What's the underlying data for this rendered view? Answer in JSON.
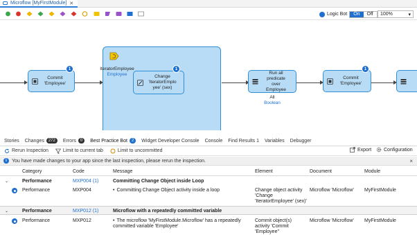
{
  "tab": {
    "title": "Microflow [MyFirstModule]",
    "close": "✕"
  },
  "toolbar": {
    "logic_bot_label": "Logic Bot",
    "toggle_on": "On",
    "toggle_off": "Off",
    "zoom": "100%",
    "zoom_chevron": "▾"
  },
  "canvas": {
    "nodes": [
      {
        "text": "Commit\n'Employee'",
        "badge": "1"
      },
      {
        "text": "Change\n'IteratorEmplo\nyee' (sex)",
        "badge": "1"
      },
      {
        "text": "Run all\npredicate\nover\nEmployee",
        "badge": ""
      },
      {
        "text": "Commit\n'Employee'",
        "badge": "1"
      }
    ],
    "loop": {
      "iterator": "IteratorEmployee",
      "list": "Employee"
    },
    "aggregate": {
      "func": "All",
      "type": "Boolean"
    }
  },
  "panel": {
    "tabs": [
      {
        "label": "Stories",
        "count": ""
      },
      {
        "label": "Changes",
        "count": "272"
      },
      {
        "label": "Errors",
        "count": "0"
      },
      {
        "label": "Best Practice Bot",
        "count": "2"
      },
      {
        "label": "Widget Developer Console",
        "count": ""
      },
      {
        "label": "Console",
        "count": ""
      },
      {
        "label": "Find Results 1",
        "count": ""
      },
      {
        "label": "Variables",
        "count": ""
      },
      {
        "label": "Debugger",
        "count": ""
      }
    ],
    "actions": {
      "rerun": "Rerun Inspection",
      "limit_tab": "Limit to current tab",
      "limit_uncommitted": "Limit to uncommitted",
      "export": "Export",
      "configuration": "Configuration"
    },
    "banner": "You have made changes to your app since the last inspection, please rerun the inspection.",
    "columns": {
      "category": "Category",
      "code": "Code",
      "message": "Message",
      "element": "Element",
      "document": "Document",
      "module": "Module"
    },
    "groups": [
      {
        "category": "Performance",
        "code": "MXP004",
        "count": "(1)",
        "message": "Committing Change Object inside Loop",
        "rows": [
          {
            "category": "Performance",
            "code": "MXP004",
            "message": "Committing Change Object activity inside a loop",
            "element": "Change object activity 'Change 'IteratorEmployee' (sex)'",
            "document": "Microflow 'Microflow'",
            "module": "MyFirstModule"
          }
        ]
      },
      {
        "category": "Performance",
        "code": "MXP012",
        "count": "(1)",
        "message": "Microflow with a repeatedly committed variable",
        "rows": [
          {
            "category": "Performance",
            "code": "MXP012",
            "message": "The microflow 'MyFirstModule.Microflow' has a repeatedly committed variable 'Employee'",
            "element": "Commit object(s) activity 'Commit 'Employee''",
            "document": "Microflow 'Microflow'",
            "module": "MyFirstModule"
          }
        ]
      }
    ]
  },
  "colors": {
    "accent": "#1f6fd0",
    "activity_fill": "#b8dcf6",
    "activity_border": "#2e8fd6"
  }
}
